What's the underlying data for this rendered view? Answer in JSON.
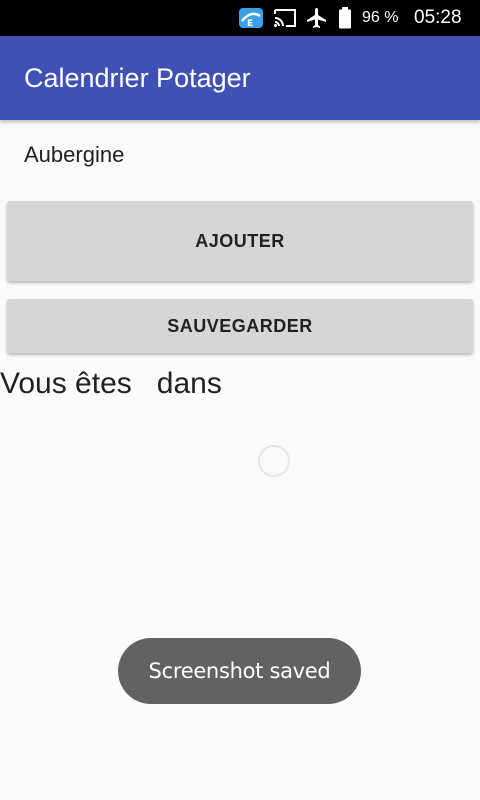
{
  "status_bar": {
    "battery_percent": "96 %",
    "time": "05:28",
    "icons": [
      "file-explorer-icon",
      "cast-icon",
      "airplane-mode-icon",
      "battery-icon"
    ]
  },
  "app_bar": {
    "title": "Calendrier Potager",
    "color": "#3f51b5"
  },
  "main": {
    "plant_name": "Aubergine",
    "add_button_label": "AJOUTER",
    "save_button_label": "SAUVEGARDER",
    "location_text": "Vous êtes   dans"
  },
  "toast": {
    "message": "Screenshot saved"
  }
}
